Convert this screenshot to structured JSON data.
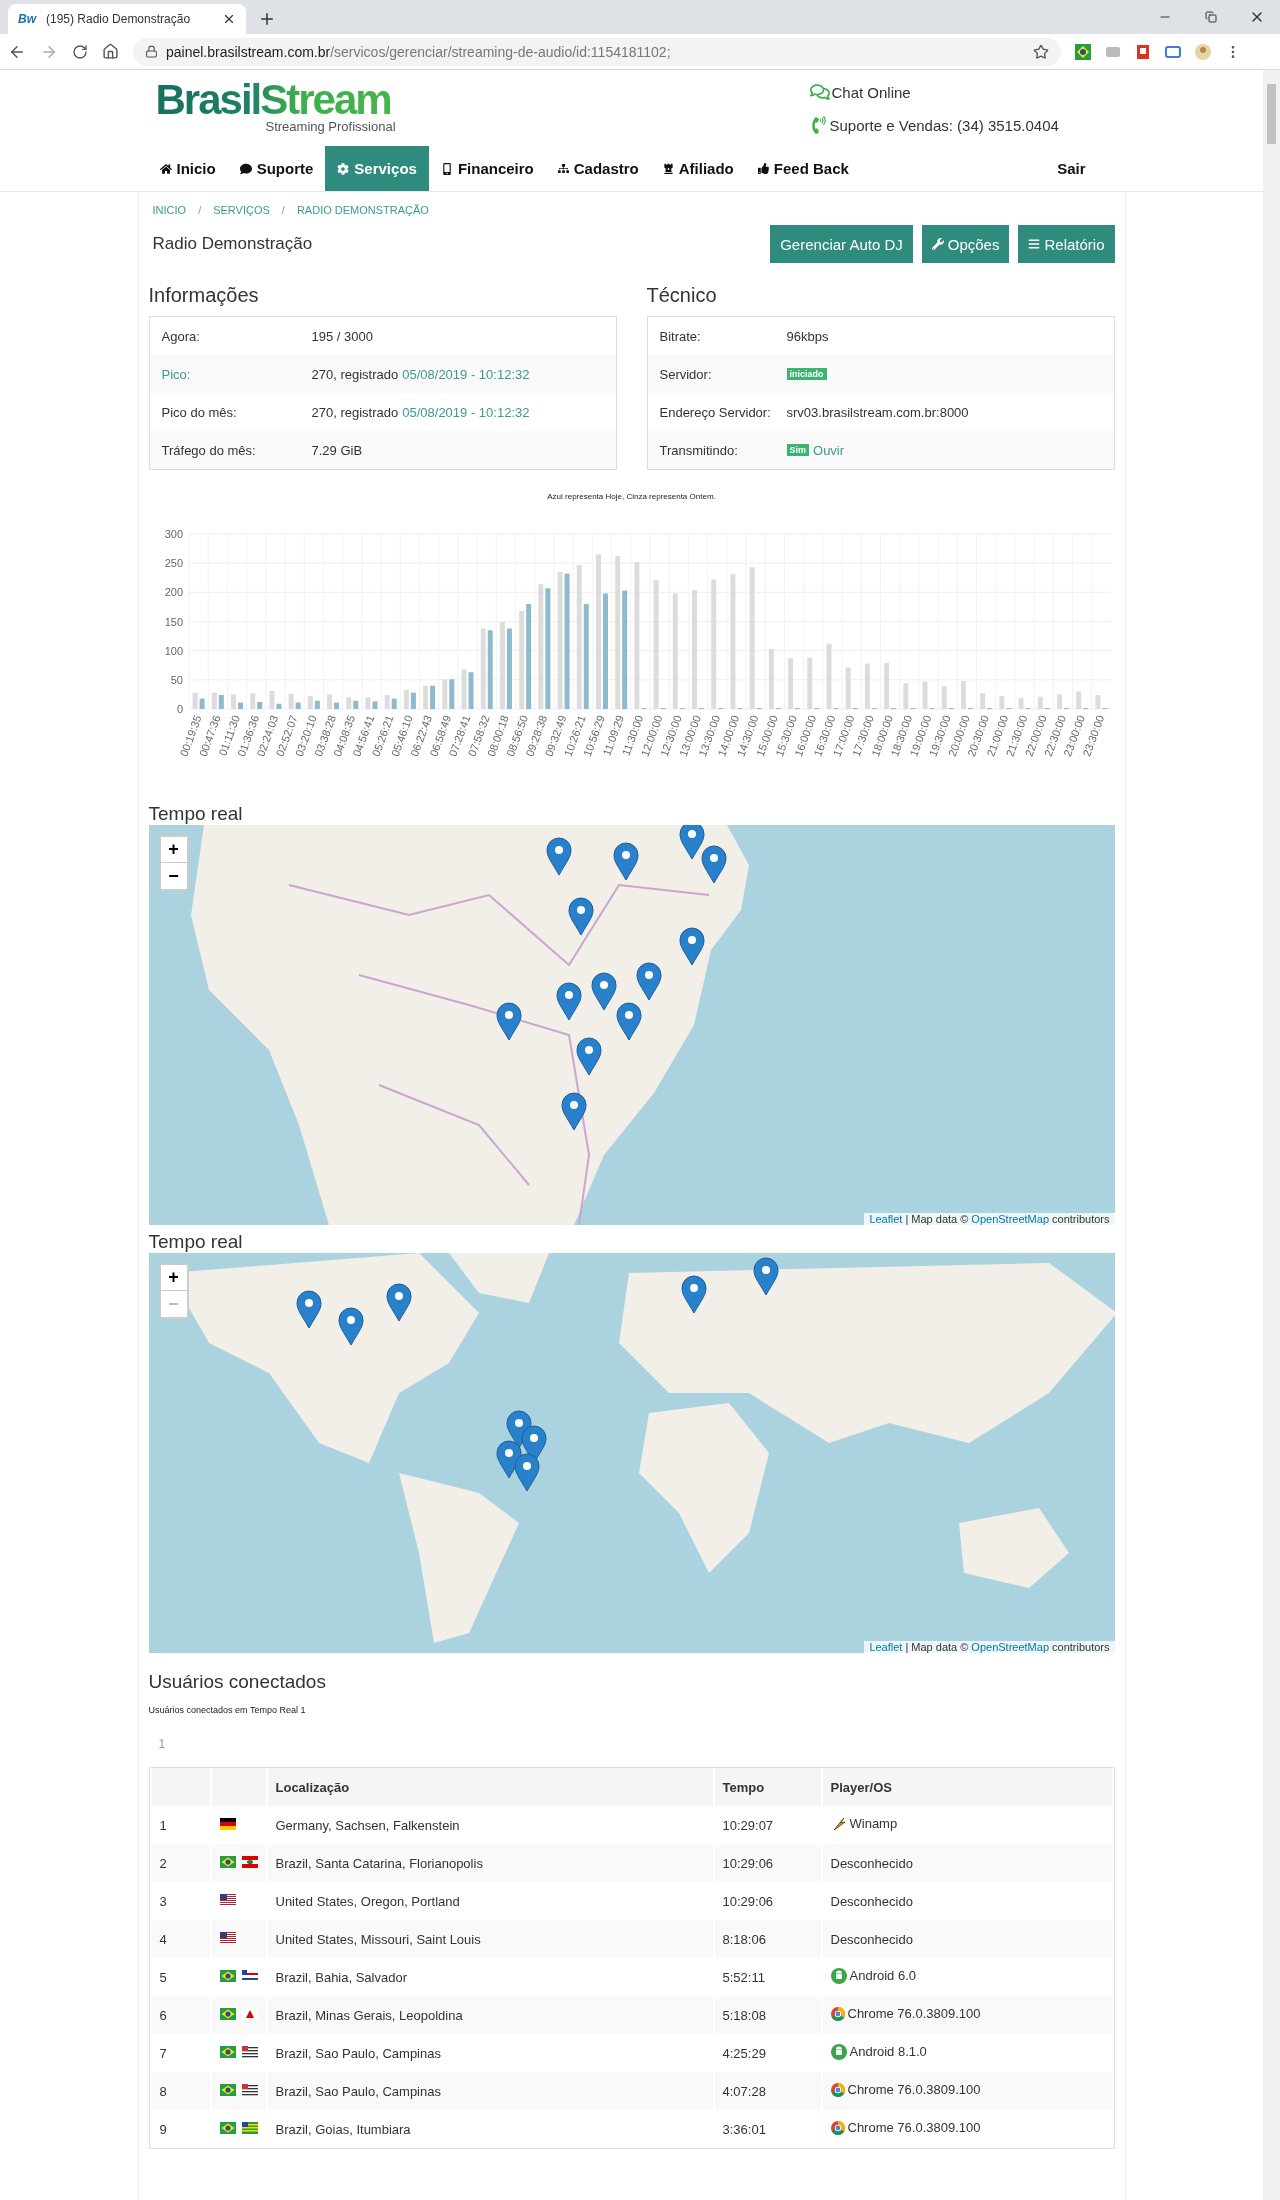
{
  "browser": {
    "favicon": "Bw",
    "tab_title": "(195) Radio Demonstração",
    "url_host": "painel.brasilstream.com.br",
    "url_path": "/servicos/gerenciar/streaming-de-audio/id:1154181102;"
  },
  "header": {
    "logo": "BrasilStream",
    "logo_sub": "Streaming Profissional",
    "contacts": [
      {
        "kind": "chat",
        "text": "Chat Online"
      },
      {
        "kind": "phone",
        "text": "Suporte e Vendas: (34) 3515.0404"
      }
    ]
  },
  "nav": [
    {
      "kind": "home",
      "label": "Inicio",
      "selected": false
    },
    {
      "kind": "comment",
      "label": "Suporte",
      "selected": false
    },
    {
      "kind": "gear",
      "label": "Serviços",
      "selected": true
    },
    {
      "kind": "mobile",
      "label": "Financeiro",
      "selected": false
    },
    {
      "kind": "sitemap",
      "label": "Cadastro",
      "selected": false
    },
    {
      "kind": "rook",
      "label": "Afiliado",
      "selected": false
    },
    {
      "kind": "thumb",
      "label": "Feed Back",
      "selected": false
    }
  ],
  "logout": "Sair",
  "breadcrumb": {
    "separator": "/",
    "items": [
      "INICIO",
      "SERVIÇOS",
      "RADIO DEMONSTRAÇÃO"
    ]
  },
  "page_title": "Radio Demonstração",
  "actions": [
    {
      "kind": "plain",
      "label": "Gerenciar Auto DJ"
    },
    {
      "kind": "wrench",
      "label": "Opções"
    },
    {
      "kind": "list",
      "label": "Relatório"
    }
  ],
  "panels": [
    {
      "title": "Informações",
      "rows": [
        {
          "label": "Agora:",
          "label_link": false,
          "parts": [
            {
              "kind": "text",
              "text": "195 / 3000"
            }
          ]
        },
        {
          "label": "Pico:",
          "label_link": true,
          "parts": [
            {
              "kind": "text",
              "text": "270, registrado"
            },
            {
              "kind": "link",
              "text": "05/08/2019 - 10:12:32"
            }
          ]
        },
        {
          "label": "Pico do mês:",
          "label_link": false,
          "parts": [
            {
              "kind": "text",
              "text": "270, registrado"
            },
            {
              "kind": "link",
              "text": "05/08/2019 - 10:12:32"
            }
          ]
        },
        {
          "label": "Tráfego do mês:",
          "label_link": false,
          "parts": [
            {
              "kind": "text",
              "text": "7.29 GiB"
            }
          ]
        }
      ]
    },
    {
      "title": "Técnico",
      "rows": [
        {
          "label": "Bitrate:",
          "label_link": false,
          "parts": [
            {
              "kind": "text",
              "text": "96kbps"
            }
          ]
        },
        {
          "label": "Servidor:",
          "label_link": false,
          "parts": [
            {
              "kind": "badge",
              "text": "iniciado"
            }
          ]
        },
        {
          "label": "Endereço Servidor:",
          "label_link": false,
          "parts": [
            {
              "kind": "text",
              "text": "srv03.brasilstream.com.br:8000"
            }
          ]
        },
        {
          "label": "Transmitindo:",
          "label_link": false,
          "parts": [
            {
              "kind": "badge",
              "text": "Sim"
            },
            {
              "kind": "link",
              "text": "Ouvir"
            }
          ]
        }
      ]
    }
  ],
  "chart_data": {
    "type": "bar",
    "title": "Azul representa Hoje, Cinza representa Ontem.",
    "categories": [
      "00:19:35",
      "00:47:36",
      "01:11:30",
      "01:36:36",
      "02:24:03",
      "02:52:07",
      "03:20:10",
      "03:38:28",
      "04:08:35",
      "04:56:41",
      "05:26:21",
      "05:46:10",
      "06:22:43",
      "06:58:49",
      "07:28:41",
      "07:58:32",
      "08:00:18",
      "08:56:50",
      "09:28:38",
      "09:32:49",
      "10:26:21",
      "10:56:29",
      "11:09:29",
      "11:30:00",
      "12:00:00",
      "12:30:00",
      "13:00:00",
      "13:30:00",
      "14:00:00",
      "14:30:00",
      "15:00:00",
      "15:30:00",
      "16:00:00",
      "16:30:00",
      "17:00:00",
      "17:30:00",
      "18:00:00",
      "18:30:00",
      "19:00:00",
      "19:30:00",
      "20:00:00",
      "20:30:00",
      "21:00:00",
      "21:30:00",
      "22:00:00",
      "22:30:00",
      "23:00:00",
      "23:30:00"
    ],
    "series": [
      {
        "color": "#dcdcdc",
        "values": [
          28,
          28,
          25,
          27,
          31,
          26,
          22,
          25,
          20,
          20,
          24,
          33,
          40,
          51,
          68,
          138,
          149,
          168,
          214,
          235,
          247,
          265,
          262,
          252,
          221,
          198,
          204,
          222,
          231,
          243,
          103,
          87,
          88,
          112,
          71,
          78,
          79,
          44,
          47,
          39,
          48,
          27,
          22,
          19,
          21,
          25,
          30,
          24
        ]
      },
      {
        "color": "#8dbacd",
        "values": [
          18,
          24,
          11,
          12,
          9,
          11,
          14,
          11,
          14,
          13,
          18,
          28,
          40,
          51,
          63,
          135,
          138,
          180,
          207,
          232,
          180,
          198,
          203,
          0,
          0,
          0,
          0,
          0,
          0,
          0,
          0,
          0,
          0,
          0,
          0,
          0,
          0,
          0,
          0,
          0,
          0,
          0,
          0,
          0,
          0,
          0,
          0,
          0
        ]
      }
    ],
    "grid": true,
    "ylim": [
      0,
      300
    ],
    "yticks": [
      0,
      50,
      100,
      150,
      200,
      250,
      300
    ]
  },
  "maps": [
    {
      "kind": "brazil",
      "title": "Tempo real",
      "zoom_in": "+",
      "zoom_out": "−",
      "zoom_out_disabled": false,
      "attribution": [
        {
          "kind": "link",
          "text": "Leaflet"
        },
        {
          "kind": "text",
          "text": "| Map data ©"
        },
        {
          "kind": "link",
          "text": "OpenStreetMap"
        },
        {
          "kind": "text",
          "text": "contributors"
        }
      ]
    },
    {
      "kind": "world",
      "title": "Tempo real",
      "zoom_in": "+",
      "zoom_out": "−",
      "zoom_out_disabled": true,
      "attribution": [
        {
          "kind": "link",
          "text": "Leaflet"
        },
        {
          "kind": "text",
          "text": "| Map data ©"
        },
        {
          "kind": "link",
          "text": "OpenStreetMap"
        },
        {
          "kind": "text",
          "text": "contributors"
        }
      ]
    }
  ],
  "users": {
    "title": "Usuários conectados",
    "subtitle": "Usuários conectados em Tempo Real 1",
    "page": "1",
    "columns": [
      "Localização",
      "Tempo",
      "Player/OS"
    ],
    "rows": [
      {
        "n": "1",
        "flags": [
          {
            "kind": "de"
          }
        ],
        "location": "Germany, Sachsen, Falkenstein",
        "time": "10:29:07",
        "player": {
          "kind": "winamp",
          "text": "Winamp"
        }
      },
      {
        "n": "2",
        "flags": [
          {
            "kind": "br"
          },
          {
            "kind": "sc"
          }
        ],
        "location": "Brazil, Santa Catarina, Florianopolis",
        "time": "10:29:06",
        "player": {
          "kind": "plain",
          "text": "Desconhecido"
        }
      },
      {
        "n": "3",
        "flags": [
          {
            "kind": "us"
          }
        ],
        "location": "United States, Oregon, Portland",
        "time": "10:29:06",
        "player": {
          "kind": "plain",
          "text": "Desconhecido"
        }
      },
      {
        "n": "4",
        "flags": [
          {
            "kind": "us"
          }
        ],
        "location": "United States, Missouri, Saint Louis",
        "time": "8:18:06",
        "player": {
          "kind": "plain",
          "text": "Desconhecido"
        }
      },
      {
        "n": "5",
        "flags": [
          {
            "kind": "br"
          },
          {
            "kind": "ba"
          }
        ],
        "location": "Brazil, Bahia, Salvador",
        "time": "5:52:11",
        "player": {
          "kind": "android",
          "text": "Android 6.0"
        }
      },
      {
        "n": "6",
        "flags": [
          {
            "kind": "br"
          },
          {
            "kind": "mg"
          }
        ],
        "location": "Brazil, Minas Gerais, Leopoldina",
        "time": "5:18:08",
        "player": {
          "kind": "chrome",
          "text": "Chrome 76.0.3809.100"
        }
      },
      {
        "n": "7",
        "flags": [
          {
            "kind": "br"
          },
          {
            "kind": "sp"
          }
        ],
        "location": "Brazil, Sao Paulo, Campinas",
        "time": "4:25:29",
        "player": {
          "kind": "android",
          "text": "Android 8.1.0"
        }
      },
      {
        "n": "8",
        "flags": [
          {
            "kind": "br"
          },
          {
            "kind": "sp"
          }
        ],
        "location": "Brazil, Sao Paulo, Campinas",
        "time": "4:07:28",
        "player": {
          "kind": "chrome",
          "text": "Chrome 76.0.3809.100"
        }
      },
      {
        "n": "9",
        "flags": [
          {
            "kind": "br"
          },
          {
            "kind": "go"
          }
        ],
        "location": "Brazil, Goias, Itumbiara",
        "time": "3:36:01",
        "player": {
          "kind": "chrome",
          "text": "Chrome 76.0.3809.100"
        }
      }
    ]
  }
}
